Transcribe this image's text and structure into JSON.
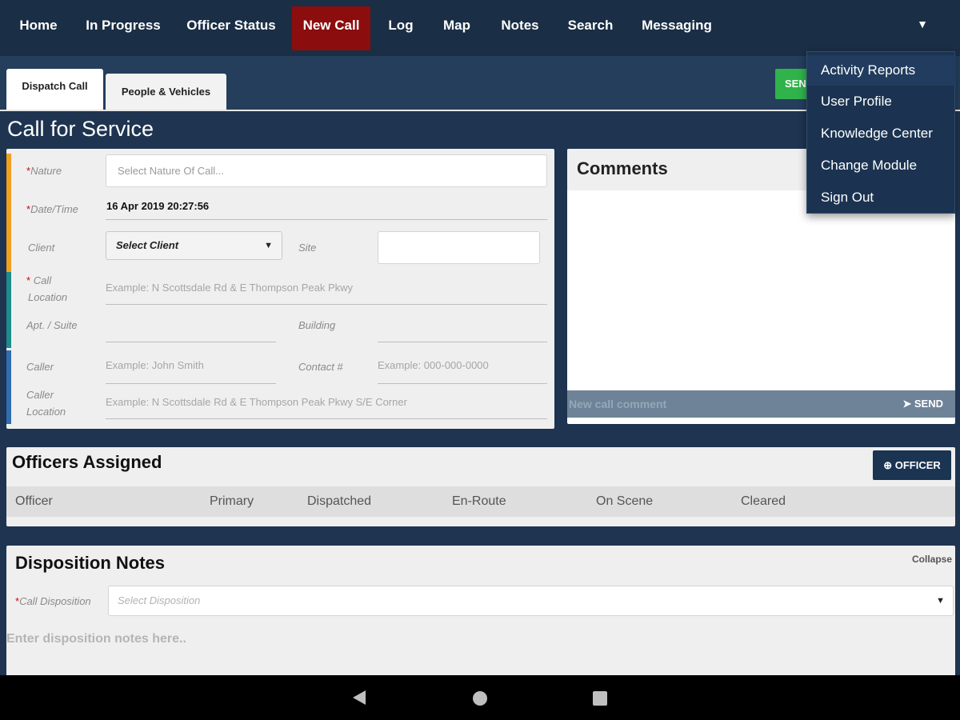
{
  "nav": {
    "items": [
      "Home",
      "In Progress",
      "Officer Status",
      "New Call",
      "Log",
      "Map",
      "Notes",
      "Search",
      "Messaging"
    ],
    "active": "New Call",
    "menu_caret": "▼"
  },
  "tabs": [
    "Dispatch Call",
    "People & Vehicles"
  ],
  "send_top_label": "SEN",
  "page_title": "Call for Service",
  "form": {
    "nature_label": "Nature",
    "nature_placeholder": "Select Nature Of Call...",
    "datetime_label": "Date/Time",
    "datetime_value": "16 Apr 2019  20:27:56",
    "client_label": "Client",
    "client_select": "Select Client",
    "site_label": "Site",
    "call_location_label_1": "Call",
    "call_location_label_2": "Location",
    "call_location_placeholder": "Example: N Scottsdale Rd & E Thompson Peak Pkwy",
    "apt_label": "Apt. / Suite",
    "building_label": "Building",
    "caller_label": "Caller",
    "caller_placeholder": "Example: John Smith",
    "contact_label": "Contact #",
    "contact_placeholder": "Example: 000-000-0000",
    "caller_location_label_1": "Caller",
    "caller_location_label_2": "Location",
    "caller_location_placeholder": "Example: N Scottsdale Rd & E Thompson Peak Pkwy S/E Corner",
    "required_mark": "*"
  },
  "comments": {
    "title": "Comments",
    "input_placeholder": "New call comment",
    "send_label": "SEND",
    "send_icon": "➤"
  },
  "officers": {
    "title": "Officers Assigned",
    "add_button": "OFFICER",
    "add_icon": "⊕",
    "columns": [
      "Officer",
      "Primary",
      "Dispatched",
      "En-Route",
      "On Scene",
      "Cleared"
    ]
  },
  "disposition": {
    "title": "Disposition Notes",
    "collapse_label": "Collapse",
    "call_disposition_label": "Call Disposition",
    "select_placeholder": "Select Disposition",
    "notes_placeholder": "Enter disposition notes here.."
  },
  "dropdown_menu": [
    "Activity Reports",
    "User Profile",
    "Knowledge Center",
    "Change Module",
    "Sign Out"
  ],
  "colors": {
    "nav_bg": "#1a2e45",
    "active_nav": "#8b0d0d",
    "send_green": "#2fb34a",
    "accent_orange": "#f0a020",
    "accent_teal": "#1e8c8c",
    "accent_blue": "#2f6db0"
  }
}
